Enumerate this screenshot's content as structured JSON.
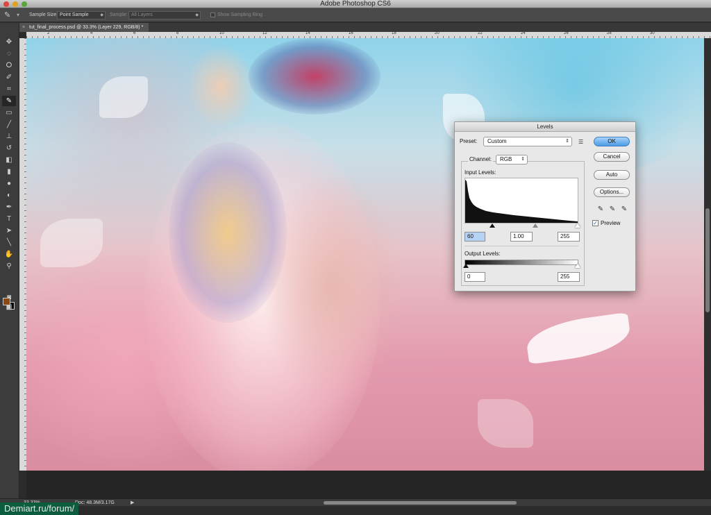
{
  "app": {
    "title": "Adobe Photoshop CS6"
  },
  "options_bar": {
    "sample_size_label": "Sample Size:",
    "sample_size_value": "Point Sample",
    "sample_label": "Sample:",
    "sample_value": "All Layers",
    "show_sampling_ring": "Show Sampling Ring"
  },
  "document_tab": {
    "title": "tut_final_process.psd @ 33.3% (Layer 229, RGB/8) *"
  },
  "ruler": {
    "top_numbers": [
      "2",
      "4",
      "6",
      "8",
      "10",
      "12",
      "14",
      "16",
      "18",
      "20",
      "22",
      "24",
      "26",
      "28",
      "30"
    ]
  },
  "tools": {
    "icons": [
      "move-icon",
      "marquee-icon",
      "lasso-icon",
      "quick-select-icon",
      "crop-icon",
      "eyedropper-icon",
      "healing-icon",
      "brush-icon",
      "stamp-icon",
      "history-brush-icon",
      "eraser-icon",
      "gradient-icon",
      "blur-icon",
      "dodge-icon",
      "pen-icon",
      "type-icon",
      "path-select-icon",
      "line-icon",
      "hand-icon",
      "zoom-icon"
    ],
    "foreground_color": "#8a4a12",
    "background_color": "#000000"
  },
  "levels": {
    "title": "Levels",
    "preset_label": "Preset:",
    "preset_value": "Custom",
    "channel_label": "Channel:",
    "channel_value": "RGB",
    "input_levels_label": "Input Levels:",
    "input_black": "60",
    "input_gamma": "1.00",
    "input_white": "255",
    "output_levels_label": "Output Levels:",
    "output_black": "0",
    "output_white": "255",
    "ok_label": "OK",
    "cancel_label": "Cancel",
    "auto_label": "Auto",
    "options_label": "Options...",
    "preview_label": "Preview",
    "preview_checked": true
  },
  "status": {
    "zoom": "33.33%",
    "doc_info": "Doc: 48.3M/3.17G"
  },
  "watermark": {
    "text": "Demiart.ru/forum/"
  }
}
